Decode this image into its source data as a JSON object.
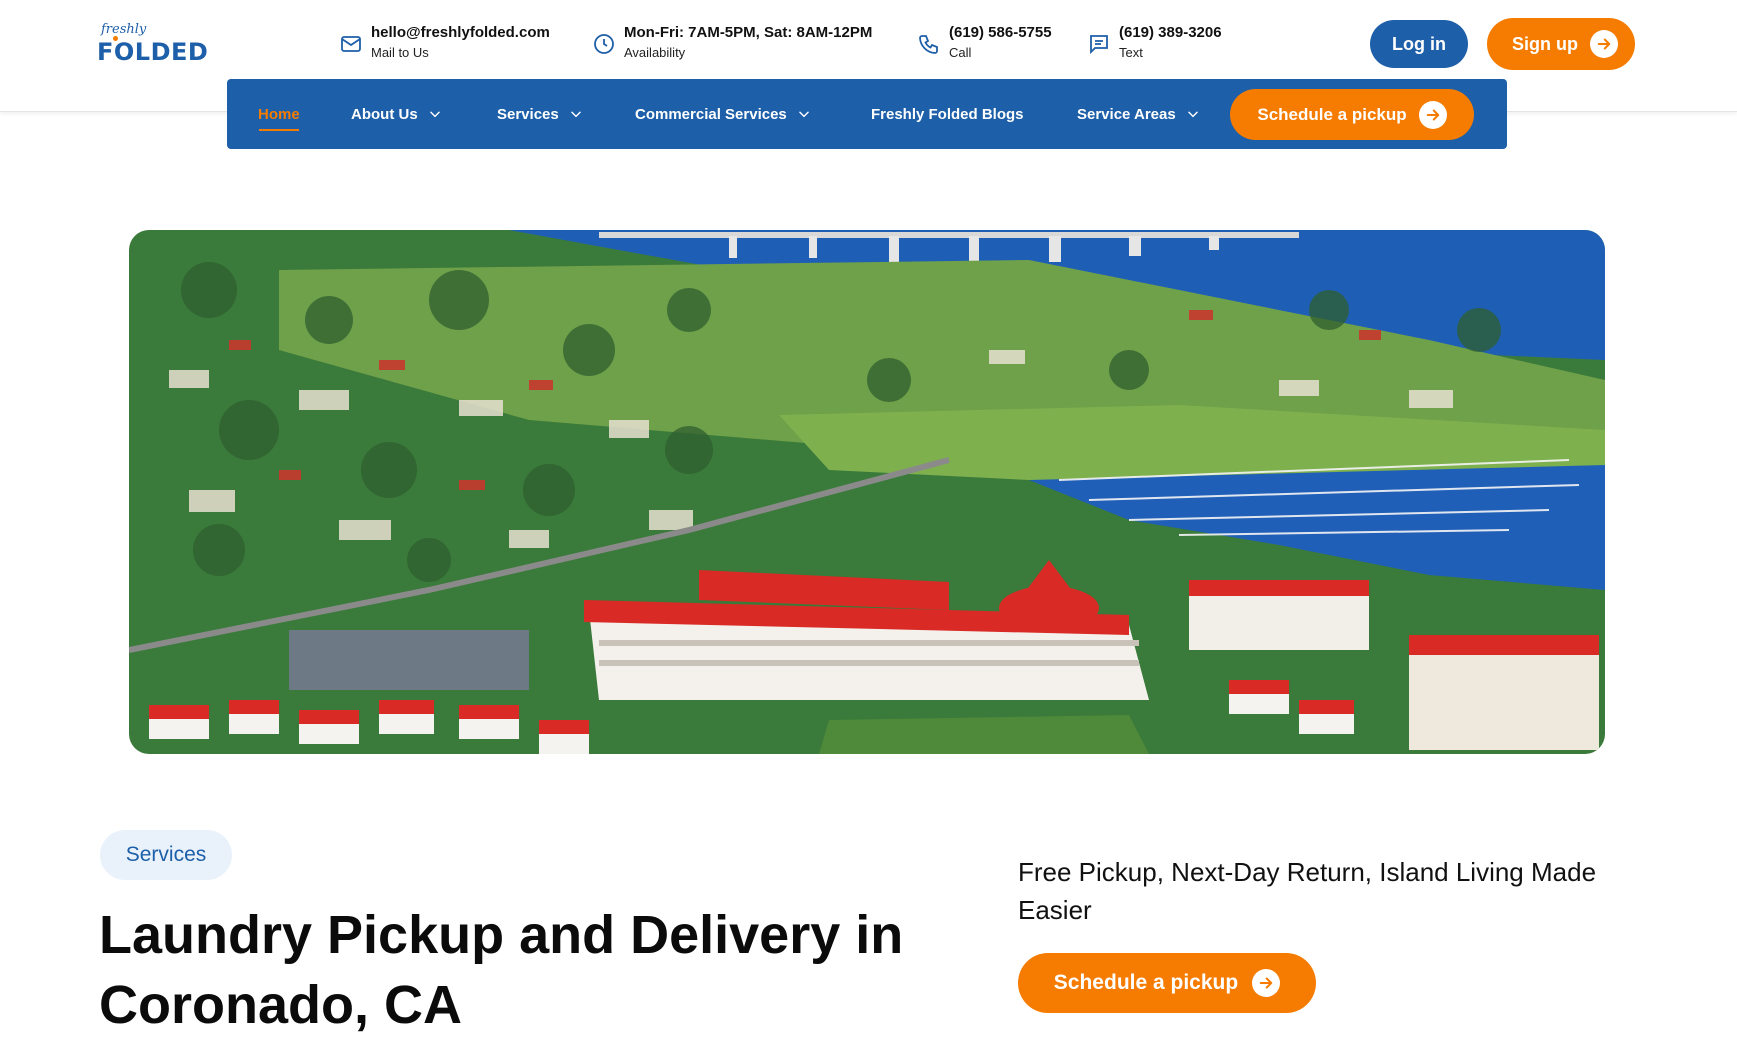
{
  "brand": {
    "logo_script": "freshly",
    "logo_word": "FOLDED"
  },
  "contacts": [
    {
      "main": "hello@freshlyfolded.com",
      "sub": "Mail to Us",
      "icon": "mail-icon"
    },
    {
      "main": "Mon-Fri: 7AM-5PM, Sat: 8AM-12PM",
      "sub": "Availability",
      "icon": "clock-icon"
    },
    {
      "main": "(619) 586-5755",
      "sub": "Call",
      "icon": "phone-icon"
    },
    {
      "main": "(619) 389-3206",
      "sub": "Text",
      "icon": "message-icon"
    }
  ],
  "auth": {
    "login_label": "Log in",
    "signup_label": "Sign up"
  },
  "nav": {
    "items": [
      {
        "label": "Home",
        "active": true
      },
      {
        "label": "About Us",
        "dropdown": true
      },
      {
        "label": "Services",
        "dropdown": true
      },
      {
        "label": "Commercial Services",
        "dropdown": true
      },
      {
        "label": "Freshly Folded Blogs"
      },
      {
        "label": "Service Areas",
        "dropdown": true
      }
    ],
    "cta_label": "Schedule a pickup"
  },
  "content": {
    "badge": "Services",
    "title": "Laundry Pickup and Delivery in Coronado, CA",
    "tagline": "Free Pickup, Next-Day Return, Island Living Made Easier",
    "cta_label": "Schedule a pickup"
  },
  "colors": {
    "primary_blue": "#1d5fa8",
    "accent_orange": "#f57c00",
    "badge_bg": "#e9f2fb"
  }
}
